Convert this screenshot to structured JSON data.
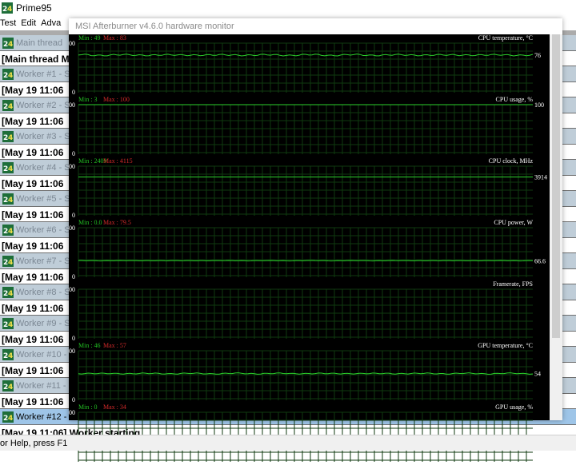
{
  "prime95": {
    "title": "Prime95",
    "menu": [
      "Test",
      "Edit",
      "Adva"
    ],
    "statusbar": "or Help, press F1",
    "workers": [
      {
        "label": "Main thread",
        "text": "[Main thread M",
        "active": false
      },
      {
        "label": "Worker #1 - S",
        "text": "[May 19 11:06",
        "active": false
      },
      {
        "label": "Worker #2 - S",
        "text": "[May 19 11:06",
        "active": false
      },
      {
        "label": "Worker #3 - S",
        "text": "[May 19 11:06",
        "active": false
      },
      {
        "label": "Worker #4 - S",
        "text": "[May 19 11:06",
        "active": false
      },
      {
        "label": "Worker #5 - S",
        "text": "[May 19 11:06",
        "active": false
      },
      {
        "label": "Worker #6 - S",
        "text": "[May 19 11:06",
        "active": false
      },
      {
        "label": "Worker #7 - S",
        "text": "[May 19 11:06",
        "active": false
      },
      {
        "label": "Worker #8 - S",
        "text": "[May 19 11:06",
        "active": false
      },
      {
        "label": "Worker #9 - S",
        "text": "[May 19 11:06",
        "active": false
      },
      {
        "label": "Worker #10 -",
        "text": "[May 19 11:06",
        "active": false
      },
      {
        "label": "Worker #11 -",
        "text": "[May 19 11:06",
        "active": false
      },
      {
        "label": "Worker #12 - S",
        "text": "[May 19 11:06] Worker starting",
        "active": true
      }
    ]
  },
  "afterburner": {
    "title": "MSI Afterburner v4.6.0 hardware monitor",
    "graphs": [
      {
        "name": "CPU temperature, °C",
        "min_label": "Min : 49",
        "max_label": "Max : 83",
        "ymax_label": "100",
        "ymin_label": "0",
        "current": "76",
        "ymax": 100,
        "level": 76,
        "noise": 1.2
      },
      {
        "name": "CPU usage, %",
        "min_label": "Min : 3",
        "max_label": "Max : 100",
        "ymax_label": "100",
        "ymin_label": "0",
        "current": "100",
        "ymax": 100,
        "level": 100,
        "noise": 0
      },
      {
        "name": "CPU clock, MHz",
        "min_label": "Min : 2409",
        "max_label": "Max : 4115",
        "ymax_label": "5000",
        "ymin_label": "0",
        "current": "3914",
        "ymax": 5000,
        "level": 3914,
        "noise": 0
      },
      {
        "name": "CPU power, W",
        "min_label": "Min : 0.0",
        "max_label": "Max : 79.5",
        "ymax_label": "200",
        "ymin_label": "0",
        "current": "66.6",
        "ymax": 200,
        "level": 66.6,
        "noise": 0.5
      },
      {
        "name": "Framerate, FPS",
        "min_label": "",
        "max_label": "",
        "ymax_label": "200",
        "ymin_label": "0",
        "current": "",
        "ymax": 200,
        "level": null,
        "noise": 0
      },
      {
        "name": "GPU temperature, °C",
        "min_label": "Min : 46",
        "max_label": "Max : 57",
        "ymax_label": "100",
        "ymin_label": "0",
        "current": "54",
        "ymax": 100,
        "level": 54,
        "noise": 0.8
      },
      {
        "name": "GPU usage, %",
        "min_label": "Min : 0",
        "max_label": "Max : 34",
        "ymax_label": "100",
        "ymin_label": "",
        "current": "",
        "ymax": 100,
        "level": null,
        "noise": 0
      }
    ]
  },
  "colors": {
    "grid": "#0f3a0f",
    "line": "#2bd12b",
    "min_text": "#22c022",
    "max_text": "#d42a2a",
    "label_text": "#ffffff"
  }
}
